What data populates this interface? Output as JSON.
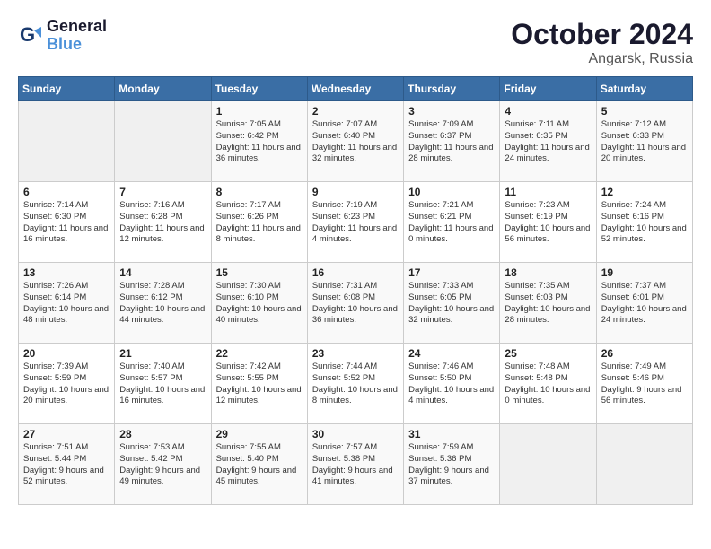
{
  "logo": {
    "line1": "General",
    "line2": "Blue"
  },
  "title": "October 2024",
  "location": "Angarsk, Russia",
  "days_of_week": [
    "Sunday",
    "Monday",
    "Tuesday",
    "Wednesday",
    "Thursday",
    "Friday",
    "Saturday"
  ],
  "weeks": [
    [
      {
        "day": "",
        "info": ""
      },
      {
        "day": "",
        "info": ""
      },
      {
        "day": "1",
        "info": "Sunrise: 7:05 AM\nSunset: 6:42 PM\nDaylight: 11 hours and 36 minutes."
      },
      {
        "day": "2",
        "info": "Sunrise: 7:07 AM\nSunset: 6:40 PM\nDaylight: 11 hours and 32 minutes."
      },
      {
        "day": "3",
        "info": "Sunrise: 7:09 AM\nSunset: 6:37 PM\nDaylight: 11 hours and 28 minutes."
      },
      {
        "day": "4",
        "info": "Sunrise: 7:11 AM\nSunset: 6:35 PM\nDaylight: 11 hours and 24 minutes."
      },
      {
        "day": "5",
        "info": "Sunrise: 7:12 AM\nSunset: 6:33 PM\nDaylight: 11 hours and 20 minutes."
      }
    ],
    [
      {
        "day": "6",
        "info": "Sunrise: 7:14 AM\nSunset: 6:30 PM\nDaylight: 11 hours and 16 minutes."
      },
      {
        "day": "7",
        "info": "Sunrise: 7:16 AM\nSunset: 6:28 PM\nDaylight: 11 hours and 12 minutes."
      },
      {
        "day": "8",
        "info": "Sunrise: 7:17 AM\nSunset: 6:26 PM\nDaylight: 11 hours and 8 minutes."
      },
      {
        "day": "9",
        "info": "Sunrise: 7:19 AM\nSunset: 6:23 PM\nDaylight: 11 hours and 4 minutes."
      },
      {
        "day": "10",
        "info": "Sunrise: 7:21 AM\nSunset: 6:21 PM\nDaylight: 11 hours and 0 minutes."
      },
      {
        "day": "11",
        "info": "Sunrise: 7:23 AM\nSunset: 6:19 PM\nDaylight: 10 hours and 56 minutes."
      },
      {
        "day": "12",
        "info": "Sunrise: 7:24 AM\nSunset: 6:16 PM\nDaylight: 10 hours and 52 minutes."
      }
    ],
    [
      {
        "day": "13",
        "info": "Sunrise: 7:26 AM\nSunset: 6:14 PM\nDaylight: 10 hours and 48 minutes."
      },
      {
        "day": "14",
        "info": "Sunrise: 7:28 AM\nSunset: 6:12 PM\nDaylight: 10 hours and 44 minutes."
      },
      {
        "day": "15",
        "info": "Sunrise: 7:30 AM\nSunset: 6:10 PM\nDaylight: 10 hours and 40 minutes."
      },
      {
        "day": "16",
        "info": "Sunrise: 7:31 AM\nSunset: 6:08 PM\nDaylight: 10 hours and 36 minutes."
      },
      {
        "day": "17",
        "info": "Sunrise: 7:33 AM\nSunset: 6:05 PM\nDaylight: 10 hours and 32 minutes."
      },
      {
        "day": "18",
        "info": "Sunrise: 7:35 AM\nSunset: 6:03 PM\nDaylight: 10 hours and 28 minutes."
      },
      {
        "day": "19",
        "info": "Sunrise: 7:37 AM\nSunset: 6:01 PM\nDaylight: 10 hours and 24 minutes."
      }
    ],
    [
      {
        "day": "20",
        "info": "Sunrise: 7:39 AM\nSunset: 5:59 PM\nDaylight: 10 hours and 20 minutes."
      },
      {
        "day": "21",
        "info": "Sunrise: 7:40 AM\nSunset: 5:57 PM\nDaylight: 10 hours and 16 minutes."
      },
      {
        "day": "22",
        "info": "Sunrise: 7:42 AM\nSunset: 5:55 PM\nDaylight: 10 hours and 12 minutes."
      },
      {
        "day": "23",
        "info": "Sunrise: 7:44 AM\nSunset: 5:52 PM\nDaylight: 10 hours and 8 minutes."
      },
      {
        "day": "24",
        "info": "Sunrise: 7:46 AM\nSunset: 5:50 PM\nDaylight: 10 hours and 4 minutes."
      },
      {
        "day": "25",
        "info": "Sunrise: 7:48 AM\nSunset: 5:48 PM\nDaylight: 10 hours and 0 minutes."
      },
      {
        "day": "26",
        "info": "Sunrise: 7:49 AM\nSunset: 5:46 PM\nDaylight: 9 hours and 56 minutes."
      }
    ],
    [
      {
        "day": "27",
        "info": "Sunrise: 7:51 AM\nSunset: 5:44 PM\nDaylight: 9 hours and 52 minutes."
      },
      {
        "day": "28",
        "info": "Sunrise: 7:53 AM\nSunset: 5:42 PM\nDaylight: 9 hours and 49 minutes."
      },
      {
        "day": "29",
        "info": "Sunrise: 7:55 AM\nSunset: 5:40 PM\nDaylight: 9 hours and 45 minutes."
      },
      {
        "day": "30",
        "info": "Sunrise: 7:57 AM\nSunset: 5:38 PM\nDaylight: 9 hours and 41 minutes."
      },
      {
        "day": "31",
        "info": "Sunrise: 7:59 AM\nSunset: 5:36 PM\nDaylight: 9 hours and 37 minutes."
      },
      {
        "day": "",
        "info": ""
      },
      {
        "day": "",
        "info": ""
      }
    ]
  ]
}
